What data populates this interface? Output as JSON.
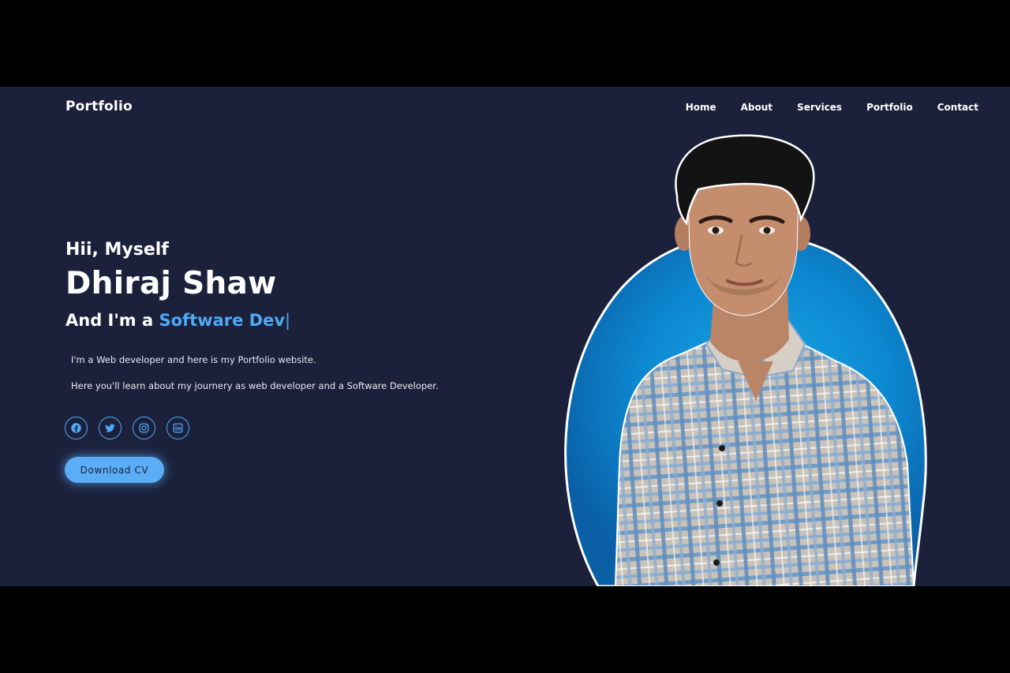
{
  "header": {
    "logo": "Portfolio",
    "nav": [
      "Home",
      "About",
      "Services",
      "Portfolio",
      "Contact"
    ]
  },
  "hero": {
    "greeting": "Hii, Myself",
    "name": "Dhiraj Shaw",
    "role_prefix": "And I'm a ",
    "role_highlight": "Software Dev",
    "cursor": "|",
    "description_line1": "I'm a Web developer and here is my Portfolio website.",
    "description_line2": "Here you'll learn about my journery as web developer and a Software Developer.",
    "socials": [
      "facebook-icon",
      "twitter-icon",
      "instagram-icon",
      "linkedin-icon"
    ],
    "cta_label": "Download CV"
  },
  "colors": {
    "background": "#1b213b",
    "accent": "#4fa9f5",
    "button": "#5badf6",
    "text": "#ffffff"
  },
  "image": {
    "subject": "portrait-photo"
  }
}
